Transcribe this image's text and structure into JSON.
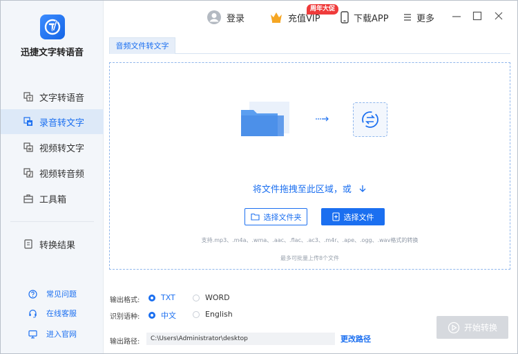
{
  "app": {
    "name": "迅捷文字转语音"
  },
  "sidebar": {
    "items": [
      {
        "label": "文字转语音",
        "icon": "text-to-speech-icon"
      },
      {
        "label": "录音转文字",
        "icon": "audio-to-text-icon",
        "active": true
      },
      {
        "label": "视频转文字",
        "icon": "video-to-text-icon"
      },
      {
        "label": "视频转音频",
        "icon": "video-to-audio-icon"
      },
      {
        "label": "工具箱",
        "icon": "toolbox-icon"
      },
      {
        "label": "转换结果",
        "icon": "results-icon"
      }
    ],
    "footer": [
      {
        "label": "常见问题",
        "icon": "question-icon"
      },
      {
        "label": "在线客服",
        "icon": "headset-icon"
      },
      {
        "label": "进入官网",
        "icon": "monitor-icon"
      }
    ]
  },
  "topbar": {
    "login": "登录",
    "vip": "充值VIP",
    "vip_badge": "周年大促",
    "download": "下载APP",
    "more": "更多"
  },
  "tab": {
    "label": "音频文件转文字"
  },
  "dropzone": {
    "prompt": "将文件拖拽至此区域，或",
    "select_folder": "选择文件夹",
    "select_file": "选择文件",
    "supported": "支持.mp3、.m4a、.wma、.aac、.flac、.ac3、.m4r、.ape、.ogg、.wav格式的转换",
    "limit": "最多可批量上传8个文件"
  },
  "options": {
    "format_label": "输出格式:",
    "format_options": [
      "TXT",
      "WORD"
    ],
    "format_selected": "TXT",
    "lang_label": "识别语种:",
    "lang_options": [
      "中文",
      "English"
    ],
    "lang_selected": "中文",
    "path_label": "输出路径:",
    "path_value": "C:\\Users\\Administrator\\desktop",
    "change_path": "更改路径"
  },
  "start_button": "开始转换",
  "colors": {
    "accent": "#1b6ff0",
    "sidebar_bg": "#f3f6fa",
    "active_bg": "#dde9f8",
    "vip_badge": "#ef3b3b",
    "disabled_button": "#d6d9de"
  }
}
